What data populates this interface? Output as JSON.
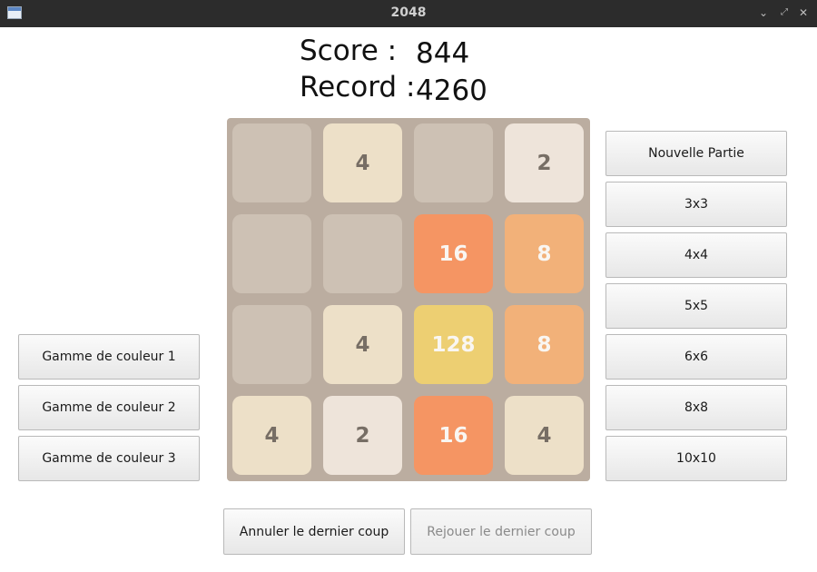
{
  "window": {
    "title": "2048"
  },
  "stats": {
    "score_label": "Score :",
    "score_value": "844",
    "record_label": "Record :",
    "record_value": "4260"
  },
  "board": {
    "size": 4,
    "tiles": [
      [
        null,
        4,
        null,
        2
      ],
      [
        null,
        null,
        16,
        8
      ],
      [
        null,
        4,
        128,
        8
      ],
      [
        4,
        2,
        16,
        4
      ]
    ]
  },
  "tile_colors": {
    "empty": "#cdc1b4",
    "2": {
      "bg": "#eee4da",
      "fg": "#776e65"
    },
    "4": {
      "bg": "#ede0c8",
      "fg": "#776e65"
    },
    "8": {
      "bg": "#f2b179",
      "fg": "#f9f6f2"
    },
    "16": {
      "bg": "#f59563",
      "fg": "#f9f6f2"
    },
    "128": {
      "bg": "#edcf72",
      "fg": "#f9f6f2"
    }
  },
  "right_menu": [
    "Nouvelle Partie",
    "3x3",
    "4x4",
    "5x5",
    "6x6",
    "8x8",
    "10x10"
  ],
  "color_schemes": [
    "Gamme de couleur 1",
    "Gamme de couleur 2",
    "Gamme de couleur 3"
  ],
  "actions": {
    "undo_label": "Annuler le dernier coup",
    "redo_label": "Rejouer le dernier coup"
  },
  "window_controls": {
    "minimize_icon": "chevron-down-icon",
    "maximize_icon": "maximize-icon",
    "close_icon": "close-icon"
  }
}
